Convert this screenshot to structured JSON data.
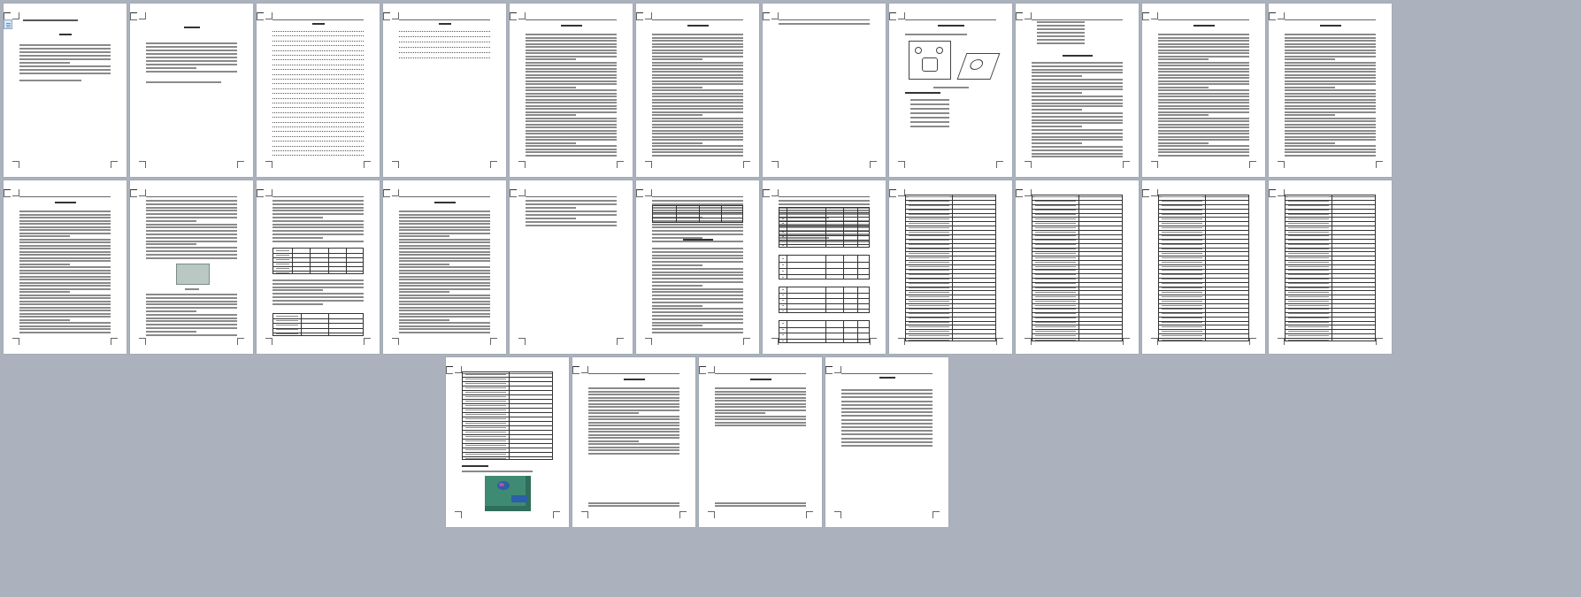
{
  "pages": [
    {
      "num": "",
      "title": "",
      "header": "",
      "kind": "cover"
    },
    {
      "num": "",
      "title": "",
      "header": "",
      "kind": "abstract"
    },
    {
      "num": "",
      "title": "",
      "header": "",
      "kind": "toc"
    },
    {
      "num": "",
      "title": "",
      "header": "",
      "kind": "toc"
    },
    {
      "num": "",
      "title": "",
      "header": "",
      "kind": "text"
    },
    {
      "num": "",
      "title": "",
      "header": "",
      "kind": "text"
    },
    {
      "num": "",
      "title": "",
      "header": "",
      "kind": "short"
    },
    {
      "num": "",
      "title": "",
      "header": "",
      "kind": "drawing"
    },
    {
      "num": "",
      "title": "",
      "header": "",
      "kind": "list"
    },
    {
      "num": "",
      "title": "",
      "header": "",
      "kind": "text"
    },
    {
      "num": "",
      "title": "",
      "header": "",
      "kind": "text"
    },
    {
      "num": "",
      "title": "",
      "header": "",
      "kind": "text"
    },
    {
      "num": "",
      "title": "",
      "header": "",
      "kind": "photo"
    },
    {
      "num": "",
      "title": "",
      "header": "",
      "kind": "tables"
    },
    {
      "num": "",
      "title": "",
      "header": "",
      "kind": "text"
    },
    {
      "num": "",
      "title": "",
      "header": "",
      "kind": "short"
    },
    {
      "num": "",
      "title": "",
      "header": "",
      "kind": "tables"
    },
    {
      "num": "",
      "title": "",
      "header": "",
      "kind": "tables"
    },
    {
      "num": "",
      "title": "",
      "header": "",
      "kind": "bigtable"
    },
    {
      "num": "",
      "title": "",
      "header": "",
      "kind": "bigtable"
    },
    {
      "num": "",
      "title": "",
      "header": "",
      "kind": "bigtable"
    },
    {
      "num": "",
      "title": "",
      "header": "",
      "kind": "bigtable"
    },
    {
      "num": "",
      "title": "",
      "header": "",
      "kind": "render"
    },
    {
      "num": "",
      "title": "",
      "header": "",
      "kind": "text"
    },
    {
      "num": "",
      "title": "",
      "header": "",
      "kind": "text"
    },
    {
      "num": "",
      "title": "",
      "header": "",
      "kind": "refs"
    }
  ],
  "colors": {
    "background": "#abb2bd",
    "page": "#ffffff",
    "text": "#8a8a8a",
    "render_green": "#3f8a73",
    "render_blue": "#2b5fa8"
  },
  "icons": {
    "thumbnail": "page-thumbnail-icon"
  }
}
